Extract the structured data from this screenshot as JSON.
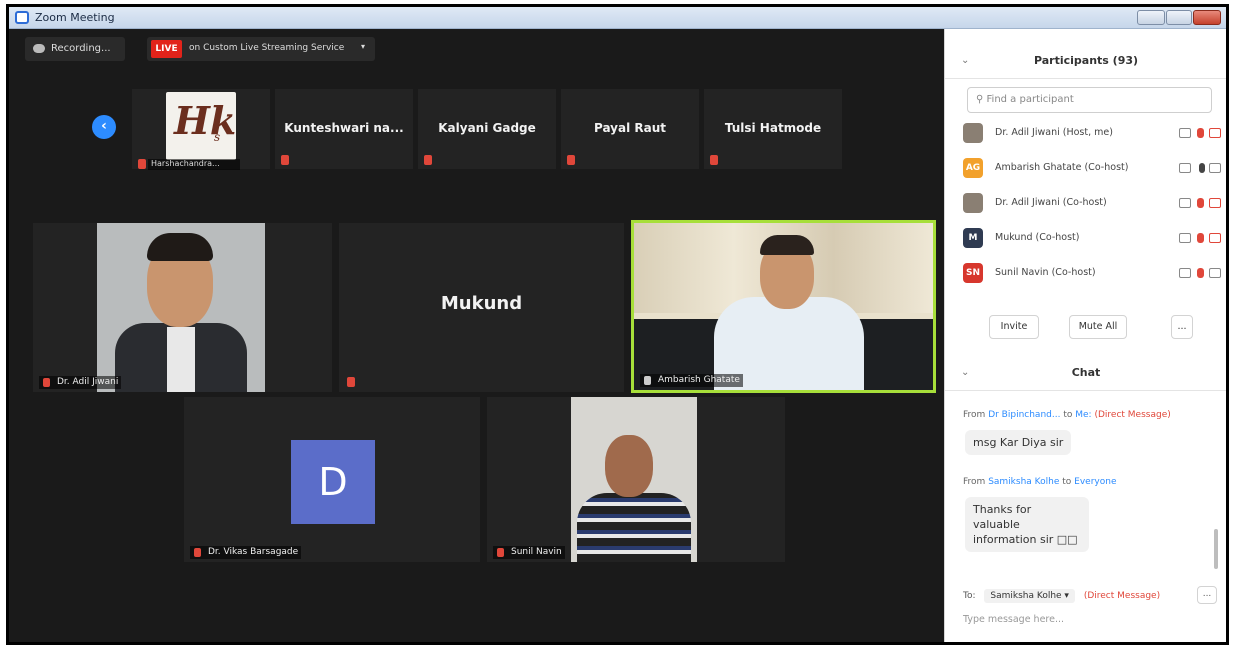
{
  "window": {
    "title": "Zoom Meeting"
  },
  "top_bar": {
    "recording_label": "Recording...",
    "live_badge": "LIVE",
    "live_service": "on Custom Live Streaming Service"
  },
  "strip": {
    "tiles": [
      {
        "caption": "Harshachandra..."
      },
      {
        "name": "Kunteshwari  na..."
      },
      {
        "name": "Kalyani Gadge"
      },
      {
        "name": "Payal Raut"
      },
      {
        "name": "Tulsi Hatmode"
      }
    ],
    "logo_text": "Hk",
    "logo_sub": "s"
  },
  "gallery": {
    "adil": "Dr. Adil Jiwani",
    "mukund": "Mukund",
    "ambarish": "Ambarish Ghatate",
    "vikas_initial": "D",
    "vikas": "Dr. Vikas Barsagade",
    "sunil": "Sunil Navin"
  },
  "participants": {
    "title": "Participants (93)",
    "search_placeholder": "Find a participant",
    "rows": [
      {
        "avatar": "",
        "name": "Dr. Adil Jiwani (Host, me)"
      },
      {
        "avatar": "AG",
        "name": "Ambarish Ghatate (Co-host)"
      },
      {
        "avatar": "",
        "name": "Dr. Adil Jiwani (Co-host)"
      },
      {
        "avatar": "M",
        "name": "Mukund (Co-host)"
      },
      {
        "avatar": "SN",
        "name": "Sunil Navin (Co-host)"
      }
    ],
    "invite_label": "Invite",
    "mute_all_label": "Mute All",
    "more_label": "..."
  },
  "chat": {
    "title": "Chat",
    "messages": [
      {
        "from_prefix": "From",
        "sender": "Dr Bipinchand...",
        "to_prefix": "to",
        "recipient": "Me:",
        "dm_tag": "(Direct Message)",
        "text": "msg Kar Diya sir"
      },
      {
        "from_prefix": "From",
        "sender": "Samiksha Kolhe",
        "to_prefix": "to",
        "recipient": "Everyone",
        "dm_tag": "",
        "text": "Thanks for valuable information sir □□"
      }
    ],
    "to_label": "To:",
    "to_value": "Samiksha Kolhe ▾",
    "to_dm": "(Direct Message)",
    "more": "...",
    "input_placeholder": "Type message here..."
  }
}
